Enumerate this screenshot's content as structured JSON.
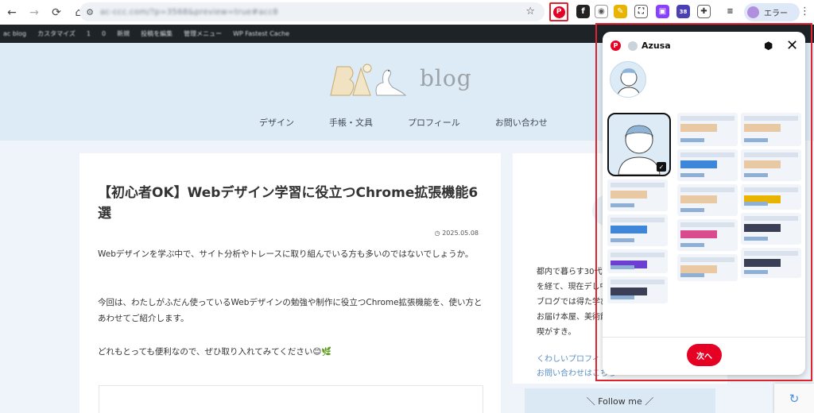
{
  "browser": {
    "url": "ac-ccc.com/?p=3568&preview=true#acc8",
    "profile_label": "エラー",
    "ext_badge": "38"
  },
  "adminbar": {
    "items": [
      "ac blog",
      "カスタマイズ",
      "1",
      "0",
      "新規",
      "投稿を編集",
      "管理メニュー",
      "WP Fastest Cache"
    ]
  },
  "site": {
    "logo_text": "blog",
    "nav": [
      "デザイン",
      "手帳・文具",
      "プロフィール",
      "お問い合わせ"
    ]
  },
  "article": {
    "title": "【初心者OK】Webデザイン学習に役立つChrome拡張機能6選",
    "date": "2025.05.08",
    "paragraphs": [
      "Webデザインを学ぶ中で、サイト分析やトレースに取り組んでいる方も多いのではないでしょうか。",
      "今回は、わたしがふだん使っているWebデザインの勉強や制作に役立つChrome拡張機能を、使い方とあわせてご紹介します。",
      "どれもとっても便利なので、ぜひ取り入れてみてください😊🌿"
    ]
  },
  "sidebar": {
    "intro": "都内で暮らす30代どを経て、現在デし中。ブログでは得た学びをお届け本屋、美術館、喫がすき。",
    "link_profile": "くわしいプロフィ",
    "link_contact": "お問い合わせはこちら",
    "follow_label": "＼ Follow me ／"
  },
  "popup": {
    "username": "Azusa",
    "next_label": "次へ"
  },
  "colors": {
    "pinterest_red": "#e60023",
    "highlight_frame": "#e0242f",
    "header_bg": "#dcebf6"
  }
}
